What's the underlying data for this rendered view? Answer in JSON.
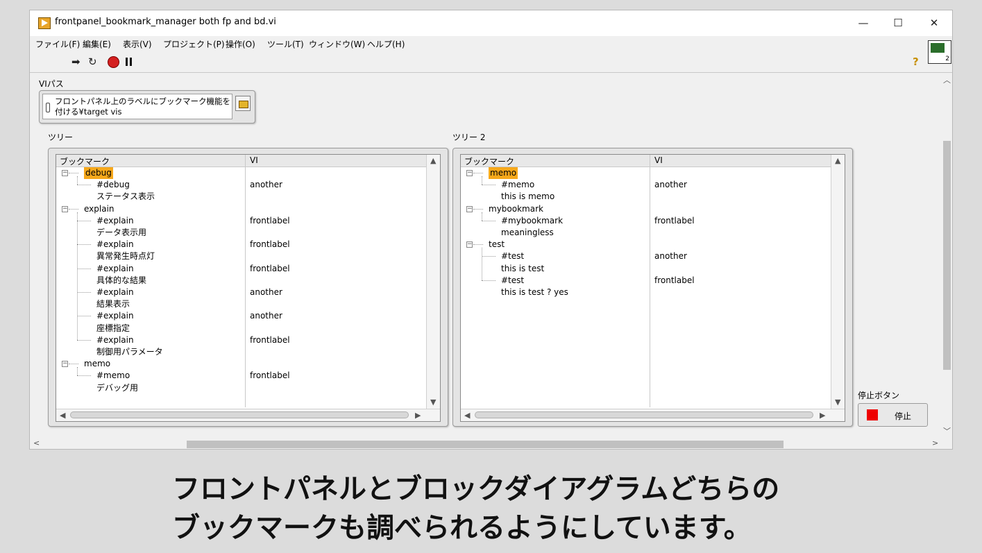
{
  "window": {
    "title": "frontpanel_bookmark_manager both fp and bd.vi",
    "minimize": "—",
    "maximize": "☐",
    "close": "✕"
  },
  "menu": [
    "ファイル(F)",
    "編集(E)",
    "表示(V)",
    "プロジェクト(P)",
    "操作(O)",
    "ツール(T)",
    "ウィンドウ(W)",
    "ヘルプ(H)"
  ],
  "toolbar": {
    "run": "➡",
    "run_continuous": "↻",
    "help": "?",
    "vi_icon_number": "2"
  },
  "vi_path": {
    "label": "VIパス",
    "value": "フロントパネル上のラベルにブックマーク機能を付ける¥target vis"
  },
  "tree1": {
    "label": "ツリー",
    "headers": [
      "ブックマーク",
      "VI"
    ],
    "rows": [
      {
        "level": 0,
        "text": "debug",
        "vi": "",
        "highlight": true,
        "expander": true
      },
      {
        "level": 1,
        "text": "#debug",
        "vi": "another"
      },
      {
        "level": 1,
        "text": "ステータス表示",
        "vi": ""
      },
      {
        "level": 0,
        "text": "explain",
        "vi": "",
        "expander": true
      },
      {
        "level": 1,
        "text": "#explain",
        "vi": "frontlabel"
      },
      {
        "level": 1,
        "text": "データ表示用",
        "vi": ""
      },
      {
        "level": 1,
        "text": "#explain",
        "vi": "frontlabel"
      },
      {
        "level": 1,
        "text": "異常発生時点灯",
        "vi": ""
      },
      {
        "level": 1,
        "text": "#explain",
        "vi": "frontlabel"
      },
      {
        "level": 1,
        "text": "具体的な結果",
        "vi": ""
      },
      {
        "level": 1,
        "text": "#explain",
        "vi": "another"
      },
      {
        "level": 1,
        "text": "結果表示",
        "vi": ""
      },
      {
        "level": 1,
        "text": "#explain",
        "vi": "another"
      },
      {
        "level": 1,
        "text": "座標指定",
        "vi": ""
      },
      {
        "level": 1,
        "text": "#explain",
        "vi": "frontlabel"
      },
      {
        "level": 1,
        "text": "制御用パラメータ",
        "vi": ""
      },
      {
        "level": 0,
        "text": "memo",
        "vi": "",
        "expander": true
      },
      {
        "level": 1,
        "text": "#memo",
        "vi": "frontlabel"
      },
      {
        "level": 1,
        "text": "デバッグ用",
        "vi": ""
      }
    ]
  },
  "tree2": {
    "label": "ツリー 2",
    "headers": [
      "ブックマーク",
      "VI"
    ],
    "rows": [
      {
        "level": 0,
        "text": "memo",
        "vi": "",
        "highlight": true,
        "expander": true
      },
      {
        "level": 1,
        "text": "#memo",
        "vi": "another"
      },
      {
        "level": 1,
        "text": "this is memo",
        "vi": ""
      },
      {
        "level": 0,
        "text": "mybookmark",
        "vi": "",
        "expander": true
      },
      {
        "level": 1,
        "text": "#mybookmark",
        "vi": "frontlabel"
      },
      {
        "level": 1,
        "text": "meaningless",
        "vi": ""
      },
      {
        "level": 0,
        "text": "test",
        "vi": "",
        "expander": true
      },
      {
        "level": 1,
        "text": "#test",
        "vi": "another"
      },
      {
        "level": 1,
        "text": "this is test",
        "vi": ""
      },
      {
        "level": 1,
        "text": "#test",
        "vi": "frontlabel"
      },
      {
        "level": 1,
        "text": "this is test ? yes",
        "vi": ""
      }
    ]
  },
  "stop": {
    "label": "停止ボタン",
    "button": "停止"
  },
  "caption": {
    "line1": "フロントパネルとブロックダイアグラムどちらの",
    "line2": "ブックマークも調べられるようにしています。"
  },
  "colors": {
    "highlight": "#f7a81b",
    "stop": "#ee0000"
  }
}
